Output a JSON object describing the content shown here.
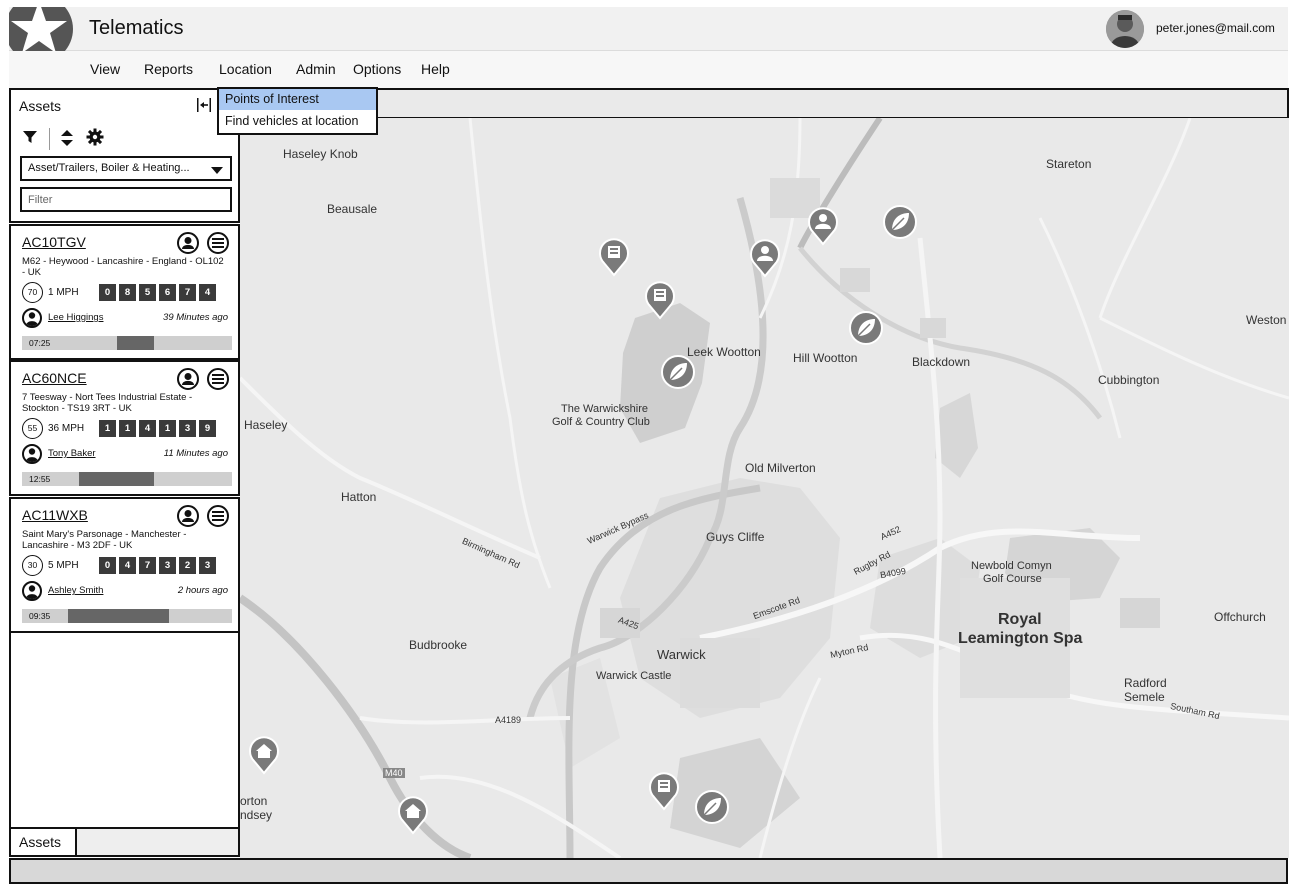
{
  "header": {
    "app_title": "Telematics",
    "user_email": "peter.jones@mail.com"
  },
  "menu": {
    "items": [
      "View",
      "Reports",
      "Location",
      "Admin",
      "Options",
      "Help"
    ]
  },
  "location_dropdown": {
    "items": [
      "Points of Interest",
      "Find vehicles at location"
    ],
    "active_index": 0
  },
  "assets_panel": {
    "title": "Assets",
    "asset_select_value": "Asset/Trailers, Boiler & Heating...",
    "filter_placeholder": "Filter",
    "tab_label": "Assets",
    "cards": [
      {
        "reg": "AC10TGV",
        "address": "M62 - Heywood - Lancashire - England - OL102 - UK",
        "speed_limit": "70",
        "speed": "1 MPH",
        "odometer": [
          "0",
          "8",
          "5",
          "6",
          "7",
          "4"
        ],
        "driver": "Lee Higgings",
        "last_seen": "39 Minutes ago",
        "time": "07:25",
        "bar_start": 0.45,
        "bar_end": 0.63
      },
      {
        "reg": "AC60NCE",
        "address": "7 Teesway - Nort Tees Industrial Estate - Stockton - TS19 3RT - UK",
        "speed_limit": "55",
        "speed": "36 MPH",
        "odometer": [
          "1",
          "1",
          "4",
          "1",
          "3",
          "9"
        ],
        "driver": "Tony Baker",
        "last_seen": "11 Minutes ago",
        "time": "12:55",
        "bar_start": 0.27,
        "bar_end": 0.63
      },
      {
        "reg": "AC11WXB",
        "address": "Saint Mary's Parsonage - Manchester - Lancashire - M3 2DF - UK",
        "speed_limit": "30",
        "speed": "5 MPH",
        "odometer": [
          "0",
          "4",
          "7",
          "3",
          "2",
          "3"
        ],
        "driver": "Ashley Smith",
        "last_seen": "2 hours ago",
        "time": "09:35",
        "bar_start": 0.22,
        "bar_end": 0.7
      }
    ]
  },
  "map": {
    "labels": [
      {
        "text": "Haseley Knob",
        "big": false
      },
      {
        "text": "Beausale",
        "big": false
      },
      {
        "text": "Stareton",
        "big": false
      },
      {
        "text": "Leek Wootton",
        "big": false
      },
      {
        "text": "Hill Wootton",
        "big": false
      },
      {
        "text": "Blackdown",
        "big": false
      },
      {
        "text": "Weston",
        "big": false
      },
      {
        "text": "Cubbington",
        "big": false
      },
      {
        "text": "The Warwickshire",
        "big": false
      },
      {
        "text": "Golf & Country Club",
        "big": false
      },
      {
        "text": "Haseley",
        "big": false
      },
      {
        "text": "Old Milverton",
        "big": false
      },
      {
        "text": "Hatton",
        "big": false
      },
      {
        "text": "Guys Cliffe",
        "big": false
      },
      {
        "text": "Newbold Comyn",
        "big": false
      },
      {
        "text": "Golf Course",
        "big": false
      },
      {
        "text": "Royal",
        "big": true
      },
      {
        "text": "Leamington Spa",
        "big": true
      },
      {
        "text": "Offchurch",
        "big": false
      },
      {
        "text": "Budbrooke",
        "big": false
      },
      {
        "text": "Warwick",
        "big": false
      },
      {
        "text": "Warwick Castle",
        "big": false
      },
      {
        "text": "Radford",
        "big": false
      },
      {
        "text": "Semele",
        "big": false
      },
      {
        "text": "orton",
        "big": false
      },
      {
        "text": "ndsey",
        "big": false
      },
      {
        "text": "Warwick Bypass",
        "big": false
      },
      {
        "text": "Birmingham Rd",
        "big": false
      },
      {
        "text": "Emscote Rd",
        "big": false
      },
      {
        "text": "Myton Rd",
        "big": false
      },
      {
        "text": "A452",
        "big": false
      },
      {
        "text": "A425",
        "big": false
      },
      {
        "text": "A4189",
        "big": false
      },
      {
        "text": "M40",
        "big": false
      },
      {
        "text": "B4099",
        "big": false
      },
      {
        "text": "Rugby Rd",
        "big": false
      },
      {
        "text": "Southam Rd",
        "big": false
      }
    ],
    "markers": [
      {
        "icon": "building-icon"
      },
      {
        "icon": "building-icon"
      },
      {
        "icon": "leaf-icon"
      },
      {
        "icon": "person-icon"
      },
      {
        "icon": "person-icon"
      },
      {
        "icon": "leaf-icon"
      },
      {
        "icon": "leaf-icon"
      },
      {
        "icon": "home-icon"
      },
      {
        "icon": "home-icon"
      },
      {
        "icon": "building-icon"
      },
      {
        "icon": "leaf-icon"
      }
    ]
  }
}
